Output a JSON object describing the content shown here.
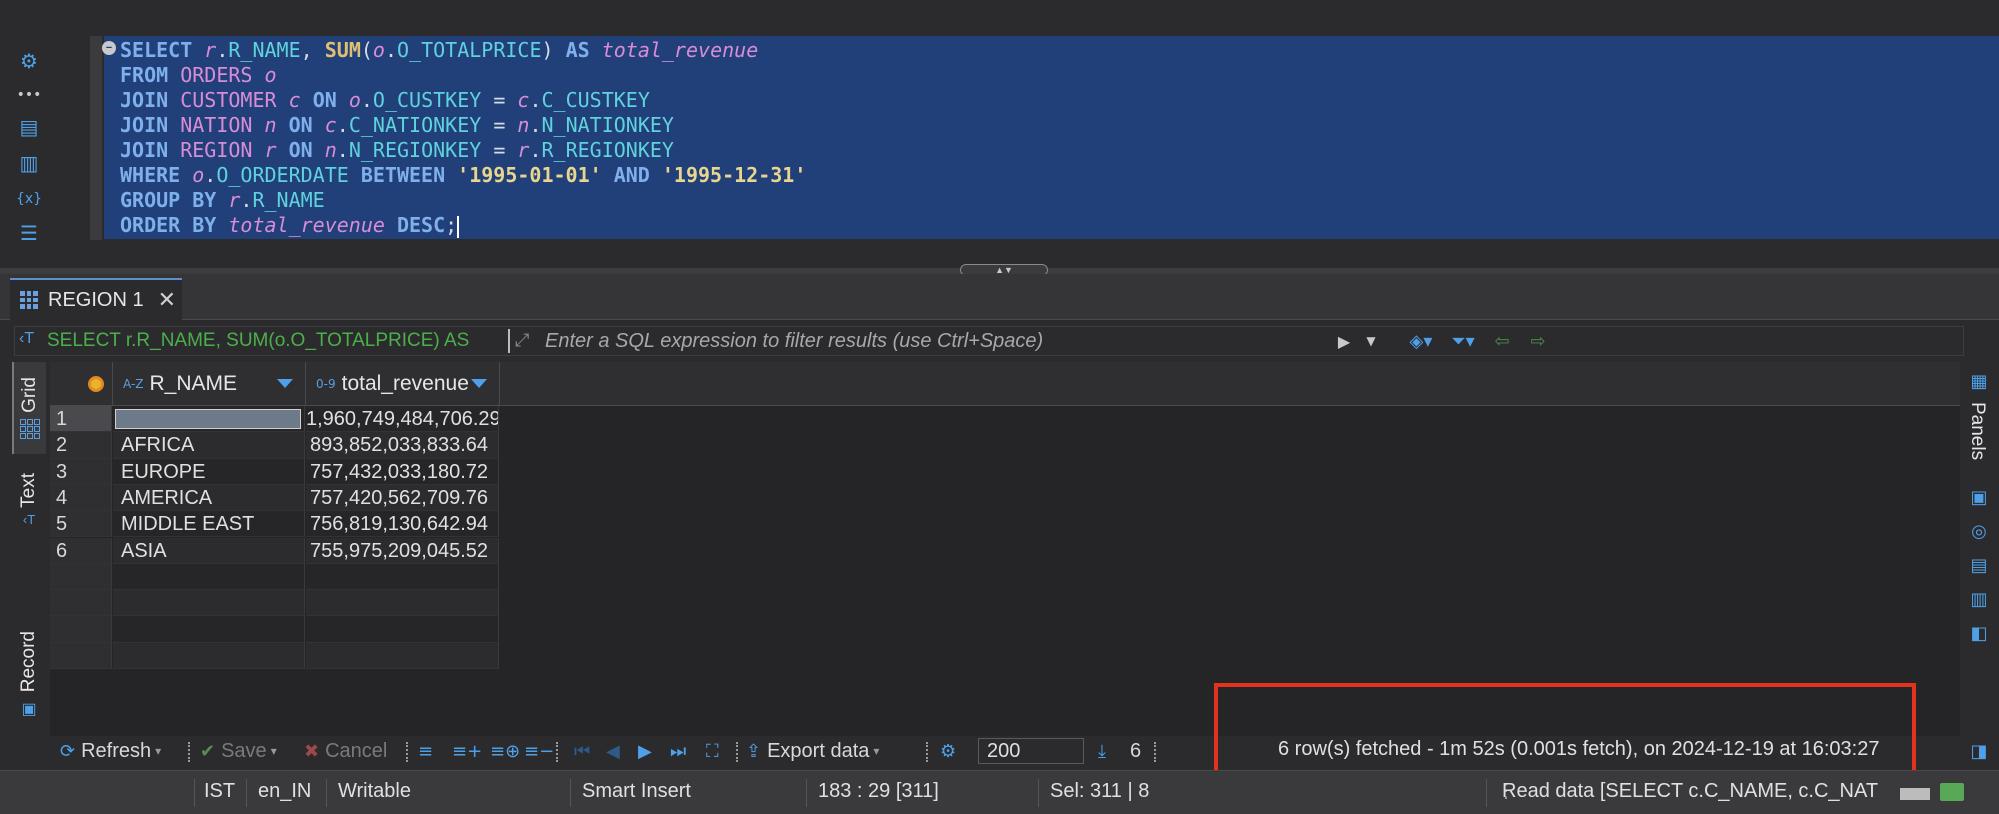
{
  "editor": {
    "lines": [
      [
        [
          "kw",
          "SELECT "
        ],
        [
          "al",
          "r"
        ],
        [
          "plain",
          "."
        ],
        [
          "col",
          "R_NAME"
        ],
        [
          "plain",
          ", "
        ],
        [
          "fn",
          "SUM"
        ],
        [
          "plain",
          "("
        ],
        [
          "al",
          "o"
        ],
        [
          "plain",
          "."
        ],
        [
          "col",
          "O_TOTALPRICE"
        ],
        [
          "plain",
          ") "
        ],
        [
          "kw",
          "AS "
        ],
        [
          "al",
          "total_revenue"
        ]
      ],
      [
        [
          "kw",
          "FROM "
        ],
        [
          "tbl",
          "ORDERS "
        ],
        [
          "al",
          "o"
        ]
      ],
      [
        [
          "kw",
          "JOIN "
        ],
        [
          "tbl",
          "CUSTOMER "
        ],
        [
          "al",
          "c "
        ],
        [
          "kw",
          "ON "
        ],
        [
          "al",
          "o"
        ],
        [
          "plain",
          "."
        ],
        [
          "col",
          "O_CUSTKEY"
        ],
        [
          "plain",
          " = "
        ],
        [
          "al",
          "c"
        ],
        [
          "plain",
          "."
        ],
        [
          "col",
          "C_CUSTKEY"
        ]
      ],
      [
        [
          "kw",
          "JOIN "
        ],
        [
          "tbl",
          "NATION "
        ],
        [
          "al",
          "n "
        ],
        [
          "kw",
          "ON "
        ],
        [
          "al",
          "c"
        ],
        [
          "plain",
          "."
        ],
        [
          "col",
          "C_NATIONKEY"
        ],
        [
          "plain",
          " = "
        ],
        [
          "al",
          "n"
        ],
        [
          "plain",
          "."
        ],
        [
          "col",
          "N_NATIONKEY"
        ]
      ],
      [
        [
          "kw",
          "JOIN "
        ],
        [
          "tbl",
          "REGION "
        ],
        [
          "al",
          "r "
        ],
        [
          "kw",
          "ON "
        ],
        [
          "al",
          "n"
        ],
        [
          "plain",
          "."
        ],
        [
          "col",
          "N_REGIONKEY"
        ],
        [
          "plain",
          " = "
        ],
        [
          "al",
          "r"
        ],
        [
          "plain",
          "."
        ],
        [
          "col",
          "R_REGIONKEY"
        ]
      ],
      [
        [
          "kw",
          "WHERE "
        ],
        [
          "al",
          "o"
        ],
        [
          "plain",
          "."
        ],
        [
          "col",
          "O_ORDERDATE "
        ],
        [
          "kw",
          "BETWEEN "
        ],
        [
          "str",
          "'1995-01-01' "
        ],
        [
          "kw",
          "AND "
        ],
        [
          "str",
          "'1995-12-31'"
        ]
      ],
      [
        [
          "kw",
          "GROUP BY "
        ],
        [
          "al",
          "r"
        ],
        [
          "plain",
          "."
        ],
        [
          "col",
          "R_NAME"
        ]
      ],
      [
        [
          "kw",
          "ORDER BY "
        ],
        [
          "al",
          "total_revenue "
        ],
        [
          "kw",
          "DESC"
        ],
        [
          "plain",
          ";"
        ]
      ]
    ],
    "fold_glyph": "−",
    "gutter_icons": [
      "gear-icon",
      "more-icon",
      "new-script-icon",
      "script-error-icon",
      "variables-icon",
      "outline-icon"
    ]
  },
  "splitter": {
    "label": "▲▼"
  },
  "results_tab": {
    "label": "REGION 1",
    "close": "✕"
  },
  "filter": {
    "query_icon": "‹T",
    "query_text": "SELECT r.R_NAME, SUM(o.O_TOTALPRICE) AS",
    "placeholder": "Enter a SQL expression to filter results (use Ctrl+Space)"
  },
  "side_tabs": {
    "grid": "Grid",
    "text": "Text",
    "record": "Record"
  },
  "right_panel": {
    "label": "Panels"
  },
  "table": {
    "columns": [
      {
        "type": "A-Z",
        "name": "R_NAME"
      },
      {
        "type": "0-9",
        "name": "total_revenue"
      }
    ],
    "rows": [
      {
        "n": "1",
        "name": "",
        "revenue": "1,960,749,484,706.29"
      },
      {
        "n": "2",
        "name": "AFRICA",
        "revenue": "893,852,033,833.64"
      },
      {
        "n": "3",
        "name": "EUROPE",
        "revenue": "757,432,033,180.72"
      },
      {
        "n": "4",
        "name": "AMERICA",
        "revenue": "757,420,562,709.76"
      },
      {
        "n": "5",
        "name": "MIDDLE EAST",
        "revenue": "756,819,130,642.94"
      },
      {
        "n": "6",
        "name": "ASIA",
        "revenue": "755,975,209,045.52"
      }
    ]
  },
  "toolbar": {
    "refresh": "Refresh",
    "save": "Save",
    "cancel": "Cancel",
    "export": "Export data",
    "fetch_size": "200",
    "row_count": "6",
    "status": "6 row(s) fetched - 1m 52s (0.001s fetch), on 2024-12-19 at 16:03:27"
  },
  "statusbar": {
    "timezone": "IST",
    "locale": "en_IN",
    "mode": "Writable",
    "insert": "Smart Insert",
    "position": "183 : 29 [311]",
    "selection": "Sel: 311 | 8",
    "task": "Read data [SELECT   c.C_NAME,  c.C_NAT"
  },
  "colors": {
    "selection": "#21407a",
    "keyword": "#7fb0ec",
    "highlight_box": "#e5321f"
  }
}
